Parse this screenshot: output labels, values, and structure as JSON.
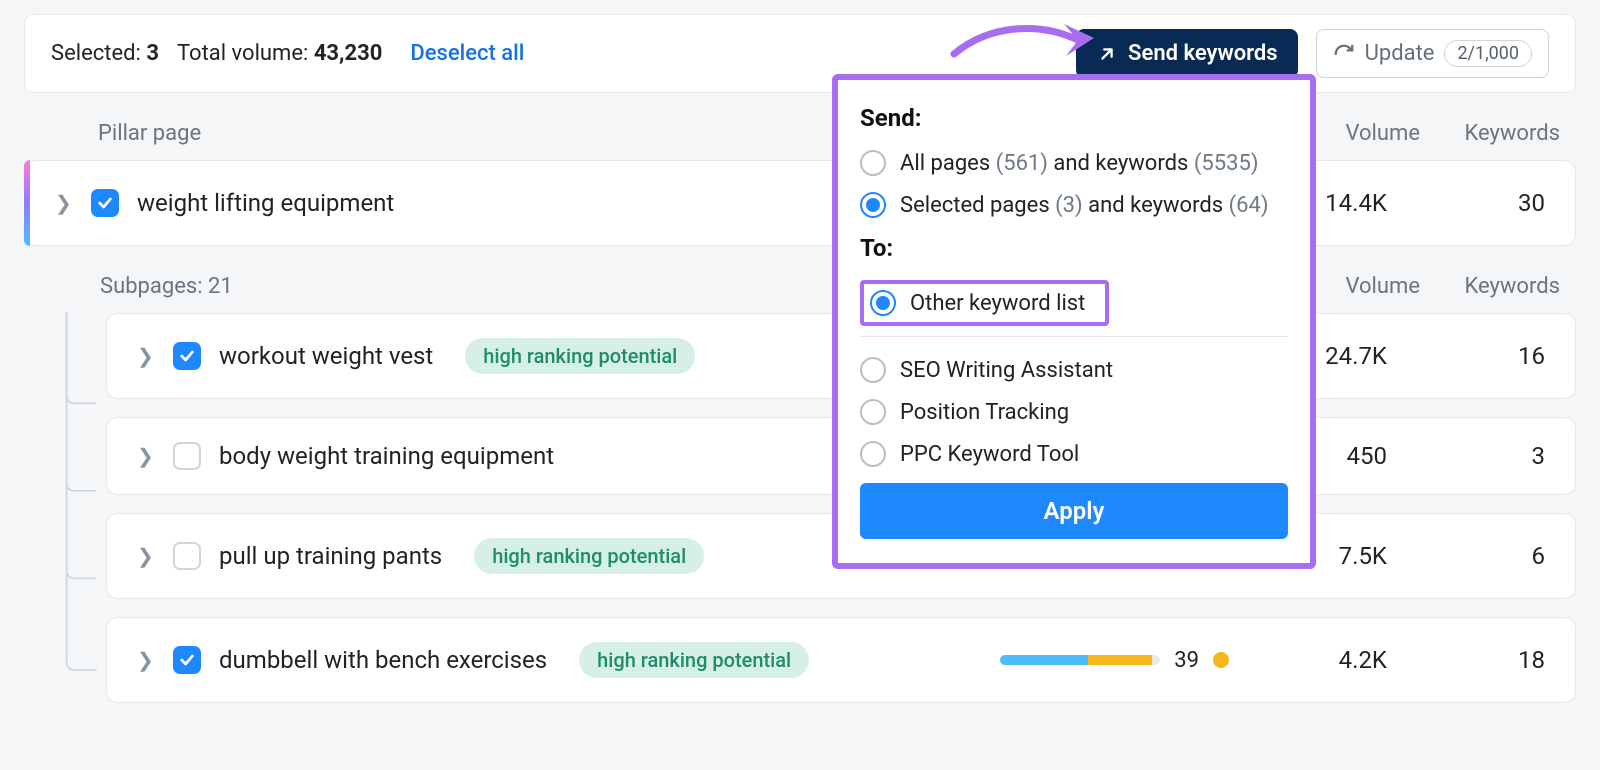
{
  "topbar": {
    "selected_label": "Selected: ",
    "selected_value": "3",
    "total_label": "Total volume: ",
    "total_value": "43,230",
    "deselect": "Deselect all",
    "send": "Send keywords",
    "update": "Update",
    "update_count": "2/1,000"
  },
  "headers": {
    "pillar": "Pillar page",
    "volume": "Volume",
    "keywords": "Keywords",
    "subpages_label": "Subpages: ",
    "subpages_count": "21"
  },
  "pillar": {
    "title": "weight lifting equipment",
    "volume": "14.4K",
    "keywords": "30"
  },
  "subs": [
    {
      "title": "workout weight vest",
      "checked": true,
      "badge": "high ranking potential",
      "volume": "24.7K",
      "keywords": "16"
    },
    {
      "title": "body weight training equipment",
      "checked": false,
      "badge": "",
      "volume": "450",
      "keywords": "3"
    },
    {
      "title": "pull up training pants",
      "checked": false,
      "badge": "high ranking potential",
      "volume": "7.5K",
      "keywords": "6"
    },
    {
      "title": "dumbbell with bench exercises",
      "checked": true,
      "badge": "high ranking potential",
      "volume": "4.2K",
      "keywords": "18",
      "score": "39"
    }
  ],
  "popup": {
    "send_label": "Send:",
    "opt_all_pre": "All pages ",
    "opt_all_p": "(561)",
    "opt_all_mid": " and keywords ",
    "opt_all_k": "(5535)",
    "opt_sel_pre": "Selected pages ",
    "opt_sel_p": "(3)",
    "opt_sel_mid": " and keywords ",
    "opt_sel_k": "(64)",
    "to_label": "To:",
    "to_options": [
      "Other keyword list",
      "SEO Writing Assistant",
      "Position Tracking",
      "PPC Keyword Tool"
    ],
    "apply": "Apply"
  }
}
